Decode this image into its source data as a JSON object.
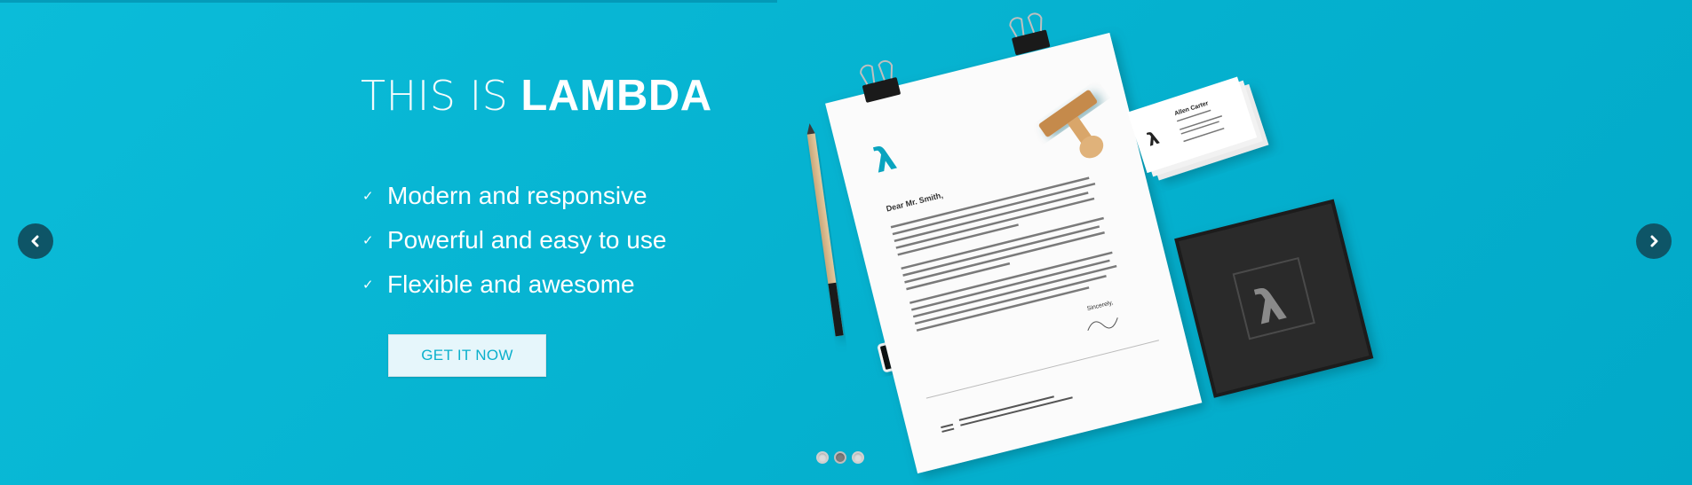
{
  "hero": {
    "title_light": "THIS IS",
    "title_bold": "LAMBDA",
    "features": [
      "Modern and responsive",
      "Powerful and easy to use",
      "Flexible and awesome"
    ],
    "cta_label": "GET IT NOW",
    "background_color": "#05b1cf",
    "cta_text_color": "#0bb0cc"
  },
  "mockup": {
    "letter_greeting": "Dear Mr. Smith,",
    "letter_signoff": "Sincerely,",
    "card_name": "Allen Carter"
  },
  "carousel": {
    "prev_icon": "chevron-left-icon",
    "next_icon": "chevron-right-icon",
    "slide_count": 3,
    "active_slide": 2
  }
}
